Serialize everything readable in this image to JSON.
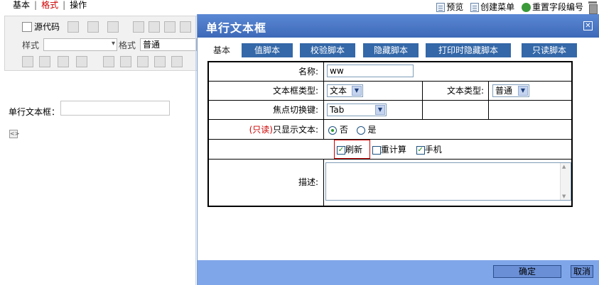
{
  "top_menu": {
    "items": [
      "基本",
      "格式",
      "操作"
    ]
  },
  "top_actions": {
    "preview": "预览",
    "create_menu": "创建菜单",
    "reset_field_no": "重置字段编号"
  },
  "editor_toolbar": {
    "source_code": "源代码",
    "style_label": "样式",
    "format_label": "格式",
    "format_value": "普通"
  },
  "left_form": {
    "field_label": "单行文本框："
  },
  "dialog": {
    "title": "单行文本框",
    "tabs": [
      "基本",
      "值脚本",
      "校验脚本",
      "隐藏脚本",
      "打印时隐藏脚本",
      "只读脚本"
    ],
    "active_tab": "基本",
    "fields": {
      "name_label": "名称:",
      "name_value": "ww",
      "textbox_type_label": "文本框类型:",
      "textbox_type_value": "文本",
      "text_type_label": "文本类型:",
      "text_type_value": "普通",
      "focus_key_label": "焦点切换键:",
      "focus_key_value": "Tab",
      "readonly_prefix": "(只读)",
      "readonly_label": "只显示文本:",
      "radio_no": "否",
      "radio_yes": "是",
      "chk_refresh": "刷新",
      "chk_recalc": "重计算",
      "chk_mobile": "手机",
      "desc_label": "描述:"
    },
    "buttons": {
      "ok": "确定",
      "cancel": "取消"
    }
  }
}
